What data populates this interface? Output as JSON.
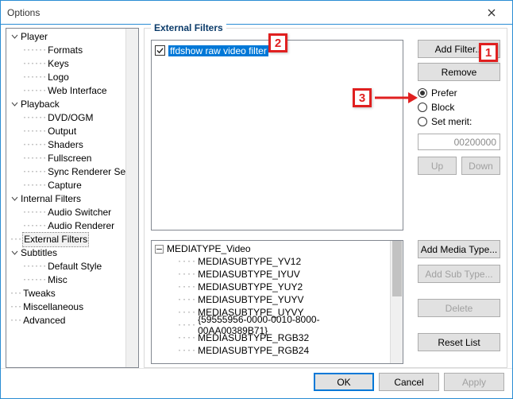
{
  "window": {
    "title": "Options"
  },
  "tree": {
    "player": {
      "label": "Player",
      "children": [
        "Formats",
        "Keys",
        "Logo",
        "Web Interface"
      ]
    },
    "playback": {
      "label": "Playback",
      "children": [
        "DVD/OGM",
        "Output",
        "Shaders",
        "Fullscreen",
        "Sync Renderer Settings",
        "Capture"
      ]
    },
    "internal": {
      "label": "Internal Filters",
      "children": [
        "Audio Switcher",
        "Audio Renderer"
      ]
    },
    "external": {
      "label": "External Filters"
    },
    "subtitles": {
      "label": "Subtitles",
      "children": [
        "Default Style",
        "Misc"
      ]
    },
    "tweaks": {
      "label": "Tweaks"
    },
    "misc": {
      "label": "Miscellaneous"
    },
    "advanced": {
      "label": "Advanced"
    }
  },
  "group": {
    "title": "External Filters"
  },
  "filterlist": {
    "item0": "ffdshow raw video filter"
  },
  "buttons": {
    "add_filter": "Add Filter...",
    "remove": "Remove",
    "up": "Up",
    "down": "Down",
    "add_media": "Add Media Type...",
    "add_sub": "Add Sub Type...",
    "delete": "Delete",
    "reset": "Reset List",
    "ok": "OK",
    "cancel": "Cancel",
    "apply": "Apply"
  },
  "radios": {
    "prefer": "Prefer",
    "block": "Block",
    "setmerit": "Set merit:"
  },
  "merit_value": "00200000",
  "subtypes": {
    "root": "MEDIATYPE_Video",
    "children": [
      "MEDIASUBTYPE_YV12",
      "MEDIASUBTYPE_IYUV",
      "MEDIASUBTYPE_YUY2",
      "MEDIASUBTYPE_YUYV",
      "MEDIASUBTYPE_UYVY",
      "{59555956-0000-0010-8000-00AA00389B71}",
      "MEDIASUBTYPE_RGB32",
      "MEDIASUBTYPE_RGB24"
    ]
  },
  "callouts": {
    "c1": "1",
    "c2": "2",
    "c3": "3"
  }
}
